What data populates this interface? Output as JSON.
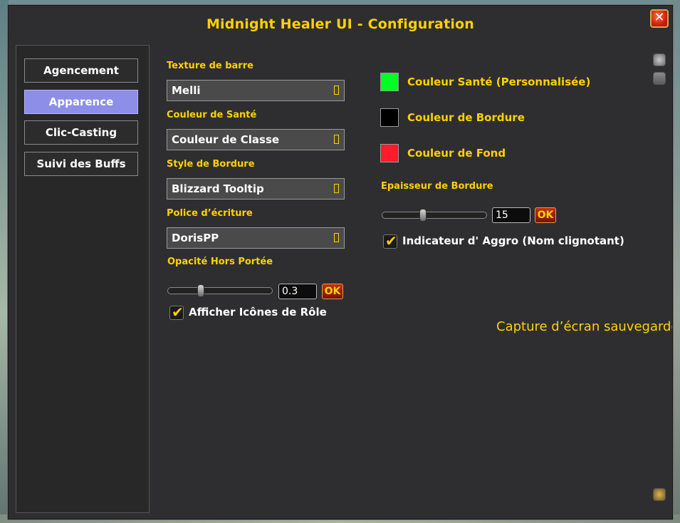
{
  "window": {
    "title": "Midnight Healer UI - Configuration",
    "close_label": "✕"
  },
  "sidebar": {
    "tabs": [
      {
        "label": "Agencement",
        "active": false
      },
      {
        "label": "Apparence",
        "active": true
      },
      {
        "label": "Clic-Casting",
        "active": false
      },
      {
        "label": "Suivi des Buffs",
        "active": false
      }
    ]
  },
  "left_column": {
    "bar_texture": {
      "label": "Texture de barre",
      "value": "Melli"
    },
    "health_color": {
      "label": "Couleur de Santé",
      "value": "Couleur de Classe"
    },
    "border_style": {
      "label": "Style de Bordure",
      "value": "Blizzard Tooltip"
    },
    "font": {
      "label": "Police d’écriture",
      "value": "DorisPP"
    },
    "out_of_range_opacity": {
      "label": "Opacité Hors Portée",
      "value": "0.3",
      "ok_label": "OK",
      "fraction": 0.3
    },
    "show_role_icons": {
      "label": "Afficher Icônes de Rôle",
      "checked": true
    }
  },
  "right_column": {
    "swatches": [
      {
        "label": "Couleur Santé (Personnalisée)",
        "color": "#00ff22"
      },
      {
        "label": "Couleur de Bordure",
        "color": "#000000"
      },
      {
        "label": "Couleur de Fond",
        "color": "#ff1a2e"
      }
    ],
    "border_thickness": {
      "label": "Epaisseur de Bordure",
      "value": "15",
      "ok_label": "OK",
      "fraction": 0.38
    },
    "aggro_indicator": {
      "label": "Indicateur d' Aggro (Nom clignotant)",
      "checked": true
    }
  },
  "notification": {
    "text": "Capture d’écran sauvegardée"
  },
  "colors": {
    "accent": "#ffd100",
    "active_tab": "#8c8ee8",
    "panel": "#2e2e30"
  }
}
